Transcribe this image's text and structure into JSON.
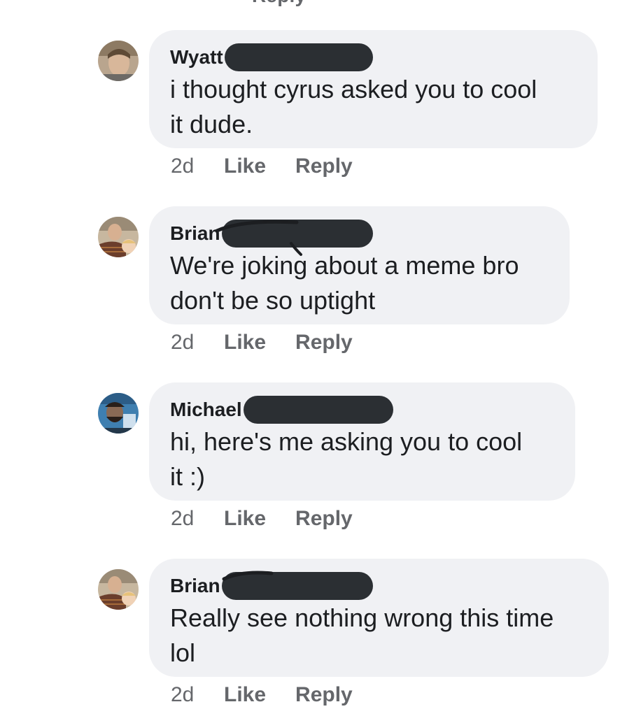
{
  "top_partial": "Reply",
  "comments": [
    {
      "author": "Wyatt",
      "text": "i thought cyrus asked you to cool\nit dude.",
      "time": "2d",
      "like": "Like",
      "reply": "Reply"
    },
    {
      "author": "Brian",
      "text": "We're joking about a meme bro\ndon't be so uptight",
      "time": "2d",
      "like": "Like",
      "reply": "Reply"
    },
    {
      "author": "Michael",
      "text": "hi, here's me asking you to cool\nit :)",
      "time": "2d",
      "like": "Like",
      "reply": "Reply"
    },
    {
      "author": "Brian",
      "text": "Really see nothing wrong this time\nlol",
      "time": "2d",
      "like": "Like",
      "reply": "Reply"
    }
  ],
  "colors": {
    "bubble": "#f0f1f4",
    "redaction": "#2b2f33",
    "secondary_text": "#65676b"
  }
}
